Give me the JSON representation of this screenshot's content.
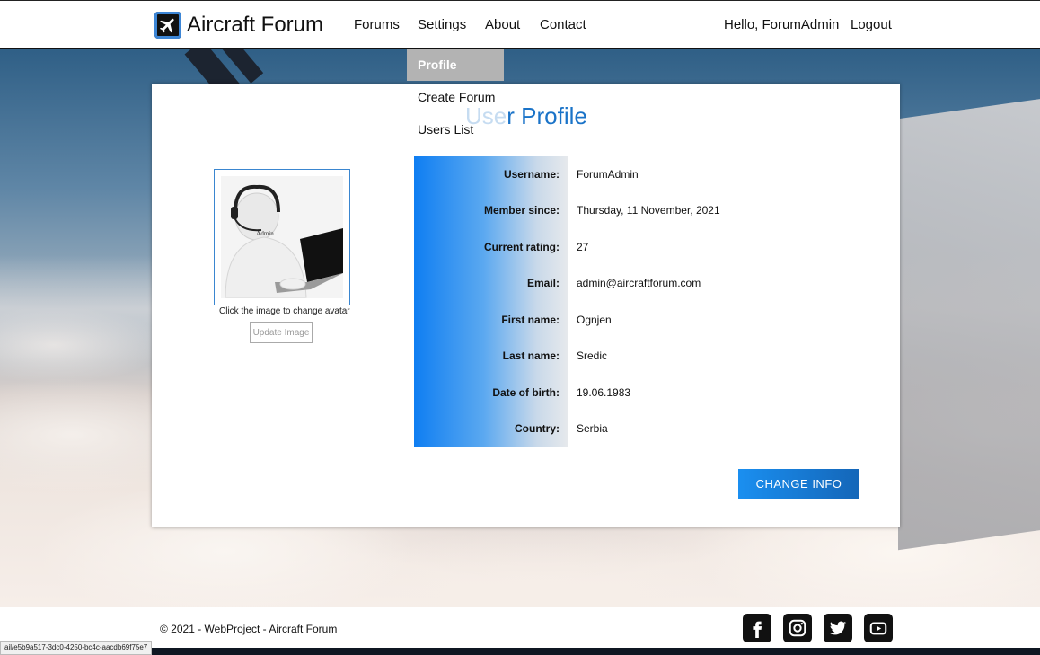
{
  "header": {
    "brand": "Aircraft Forum",
    "nav": [
      "Forums",
      "Settings",
      "About",
      "Contact"
    ],
    "greeting": "Hello, ForumAdmin",
    "logout": "Logout"
  },
  "settings_menu": {
    "items": [
      "Profile",
      "Create Forum",
      "Users List"
    ],
    "active": "Profile"
  },
  "profile": {
    "title_faded": "Use",
    "title_rest": "r Profile",
    "avatar_badge": "Admin",
    "avatar_hint": "Click the image to change avatar",
    "update_button": "Update Image",
    "fields": [
      {
        "label": "Username:",
        "value": "ForumAdmin"
      },
      {
        "label": "Member since:",
        "value": "Thursday, 11 November, 2021"
      },
      {
        "label": "Current rating:",
        "value": "27"
      },
      {
        "label": "Email:",
        "value": "admin@aircraftforum.com"
      },
      {
        "label": "First name:",
        "value": "Ognjen"
      },
      {
        "label": "Last name:",
        "value": "Sredic"
      },
      {
        "label": "Date of birth:",
        "value": "19.06.1983"
      },
      {
        "label": "Country:",
        "value": "Serbia"
      }
    ],
    "change_button": "CHANGE INFO"
  },
  "footer": {
    "copyright": "© 2021 - WebProject - Aircraft Forum",
    "social_icons": [
      "facebook-icon",
      "instagram-icon",
      "twitter-icon",
      "youtube-icon"
    ]
  },
  "status_bar": {
    "url": "ail/e5b9a517-3dc0-4250-bc4c-aacdb69f75e7"
  },
  "colors": {
    "accent": "#1a73c8",
    "button_gradient_start": "#1a8ff0",
    "button_gradient_end": "#1466b8",
    "menu_active_bg": "#b3b3b3"
  }
}
